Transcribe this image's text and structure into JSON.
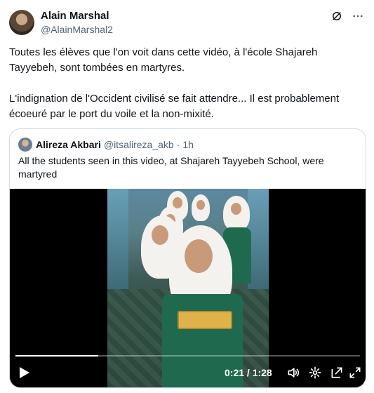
{
  "author": {
    "display_name": "Alain Marshal",
    "handle": "@AlainMarshal2"
  },
  "header_icons": [
    "grok-icon",
    "more-icon"
  ],
  "tweet_text": "Toutes les élèves que l'on voit dans cette vidéo, à l'école Shajareh Tayyebeh, sont tombées en martyres.\n\nL'indignation de l'Occident civilisé se fait attendre... Il est probablement écoeuré par le port du voile et la non-mixité.",
  "quoted": {
    "display_name": "Alireza Akbari",
    "handle": "@itsalireza_akb",
    "separator": "·",
    "time": "1h",
    "text": "All the students seen in this video, at Shajareh Tayyebeh School, were martyred"
  },
  "video": {
    "time_display": "0:21 / 1:28",
    "progress_fraction": 0.24,
    "controls": [
      "play-icon",
      "volume-icon",
      "settings-icon",
      "pip-icon",
      "fullscreen-icon"
    ]
  }
}
